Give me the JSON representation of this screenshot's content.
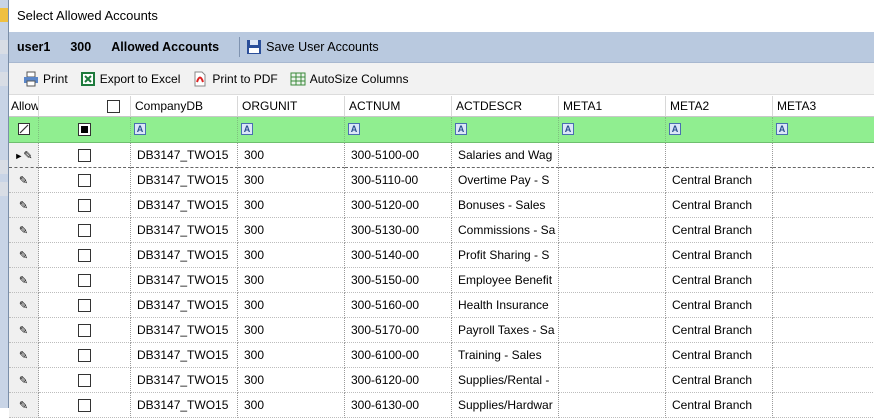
{
  "window": {
    "title": "Select Allowed Accounts"
  },
  "userbar": {
    "user": "user1",
    "org": "300",
    "section": "Allowed Accounts",
    "save_label": "Save User Accounts"
  },
  "toolbar": {
    "print_label": "Print",
    "excel_label": "Export to Excel",
    "pdf_label": "Print to PDF",
    "autosize_label": "AutoSize Columns"
  },
  "grid": {
    "columns": [
      "Allowed",
      "CompanyDB",
      "ORGUNIT",
      "ACTNUM",
      "ACTDESCR",
      "META1",
      "META2",
      "META3"
    ],
    "filter_icon_glyph": "A",
    "rows": [
      {
        "company": "DB3147_TWO15",
        "orgunit": "300",
        "actnum": "300-5100-00",
        "actdescr": "Salaries and Wag",
        "meta1": "",
        "meta2": "",
        "meta3": ""
      },
      {
        "company": "DB3147_TWO15",
        "orgunit": "300",
        "actnum": "300-5110-00",
        "actdescr": "Overtime Pay - S",
        "meta1": "",
        "meta2": "Central Branch",
        "meta3": ""
      },
      {
        "company": "DB3147_TWO15",
        "orgunit": "300",
        "actnum": "300-5120-00",
        "actdescr": "Bonuses - Sales",
        "meta1": "",
        "meta2": "Central Branch",
        "meta3": ""
      },
      {
        "company": "DB3147_TWO15",
        "orgunit": "300",
        "actnum": "300-5130-00",
        "actdescr": "Commissions - Sa",
        "meta1": "",
        "meta2": "Central Branch",
        "meta3": ""
      },
      {
        "company": "DB3147_TWO15",
        "orgunit": "300",
        "actnum": "300-5140-00",
        "actdescr": "Profit Sharing - S",
        "meta1": "",
        "meta2": "Central Branch",
        "meta3": ""
      },
      {
        "company": "DB3147_TWO15",
        "orgunit": "300",
        "actnum": "300-5150-00",
        "actdescr": "Employee Benefit",
        "meta1": "",
        "meta2": "Central Branch",
        "meta3": ""
      },
      {
        "company": "DB3147_TWO15",
        "orgunit": "300",
        "actnum": "300-5160-00",
        "actdescr": "Health Insurance",
        "meta1": "",
        "meta2": "Central Branch",
        "meta3": ""
      },
      {
        "company": "DB3147_TWO15",
        "orgunit": "300",
        "actnum": "300-5170-00",
        "actdescr": "Payroll Taxes - Sa",
        "meta1": "",
        "meta2": "Central Branch",
        "meta3": ""
      },
      {
        "company": "DB3147_TWO15",
        "orgunit": "300",
        "actnum": "300-6100-00",
        "actdescr": "Training - Sales",
        "meta1": "",
        "meta2": "Central Branch",
        "meta3": ""
      },
      {
        "company": "DB3147_TWO15",
        "orgunit": "300",
        "actnum": "300-6120-00",
        "actdescr": "Supplies/Rental -",
        "meta1": "",
        "meta2": "Central Branch",
        "meta3": ""
      },
      {
        "company": "DB3147_TWO15",
        "orgunit": "300",
        "actnum": "300-6130-00",
        "actdescr": "Supplies/Hardwar",
        "meta1": "",
        "meta2": "Central Branch",
        "meta3": ""
      }
    ]
  },
  "colors": {
    "filter_row": "#90ee90",
    "userbar": "#b9c9df"
  }
}
